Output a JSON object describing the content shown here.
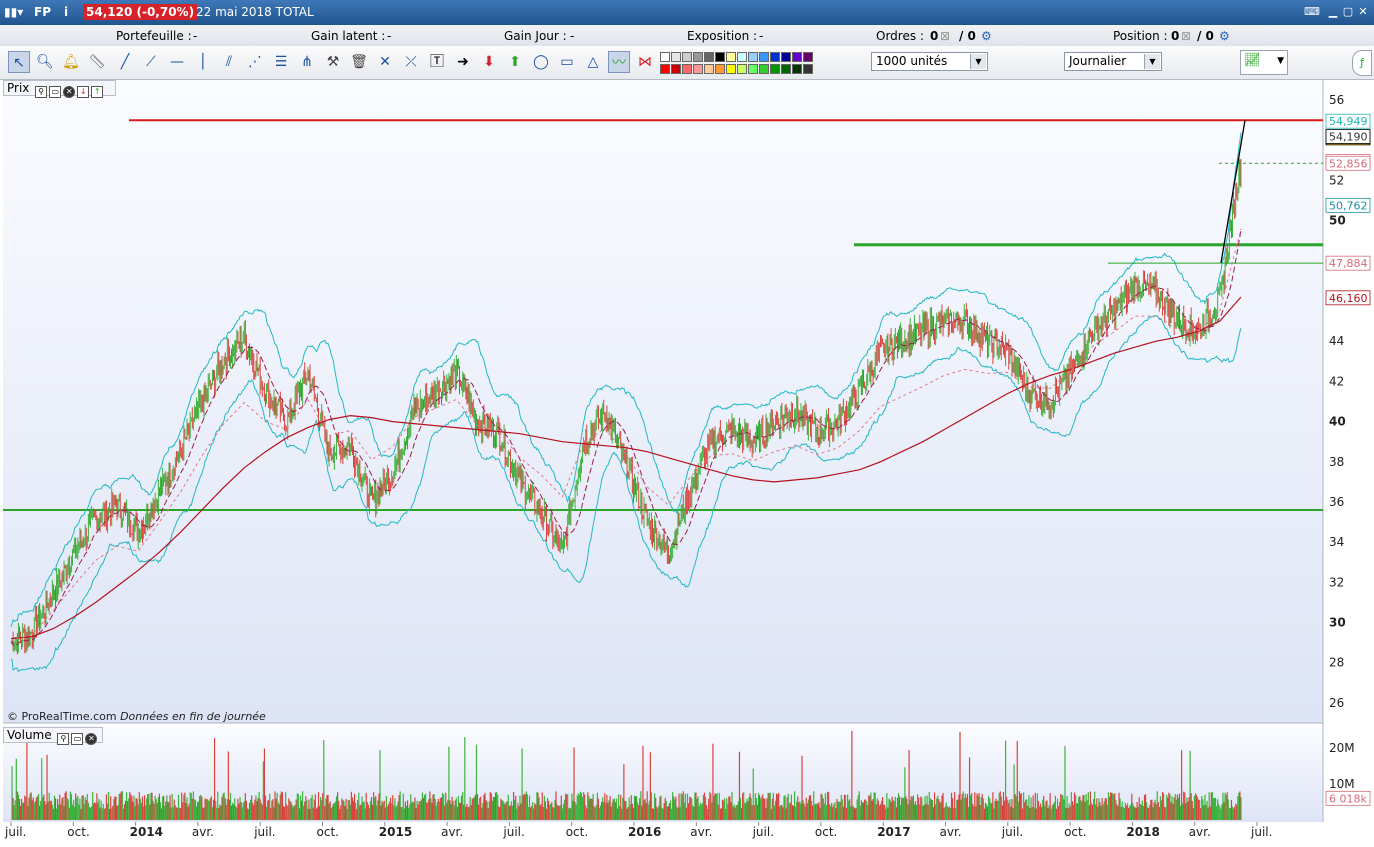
{
  "titlebar": {
    "symbol": "FP",
    "price_change": "54,120 (-0,70%)",
    "date_product": "22 mai 2018 TOTAL"
  },
  "infobar": {
    "portefeuille": "Portefeuille :",
    "portefeuille_val": "-",
    "gain_latent": "Gain latent :",
    "gain_latent_val": "-",
    "gain_jour": "Gain Jour :",
    "gain_jour_val": "-",
    "exposition": "Exposition :",
    "exposition_val": "-",
    "ordres": "Ordres :",
    "ordres_a": "0",
    "ordres_b": "/ 0",
    "position": "Position :",
    "position_a": "0",
    "position_b": "/ 0"
  },
  "toolbar": {
    "quantity_value": "1000 unités",
    "period_value": "Journalier",
    "palette_colors": [
      "#ffffff",
      "#e6e6e6",
      "#cccccc",
      "#999999",
      "#666666",
      "#000000",
      "#ffff99",
      "#ccffff",
      "#99ccff",
      "#3399ff",
      "#0033cc",
      "#000099",
      "#6600cc",
      "#660066",
      "#ff0000",
      "#cc0000",
      "#ff6666",
      "#ff9999",
      "#ffcc99",
      "#ff9933",
      "#ffff00",
      "#ccff66",
      "#66ff66",
      "#33cc33",
      "#009900",
      "#006600",
      "#003300",
      "#333333"
    ]
  },
  "price_panel": {
    "label": "Prix",
    "watermark": "© ProRealTime.com",
    "watermark_note": "Données en fin de journée",
    "y_ticks": [
      "56",
      "52",
      "50",
      "44",
      "42",
      "40",
      "38",
      "36",
      "34",
      "32",
      "30",
      "28",
      "26"
    ],
    "price_tags": [
      {
        "text": "54,949",
        "color": "#21b3b3"
      },
      {
        "text": "54,120",
        "color": "#000000",
        "bg": "#f5c518"
      },
      {
        "text": "54,190",
        "color": "#000000"
      },
      {
        "text": "52,856",
        "color": "#d66b7a"
      },
      {
        "text": "52,856",
        "color": "#d66b7a"
      },
      {
        "text": "50,762",
        "color": "#1a8fa0"
      },
      {
        "text": "47,884",
        "color": "#d66b7a"
      },
      {
        "text": "46,160",
        "color": "#b3121d"
      }
    ]
  },
  "volume_panel": {
    "label": "Volume",
    "y_ticks": [
      "20M",
      "10M"
    ],
    "last_value": "6 018k"
  },
  "x_axis": {
    "labels": [
      "juil.",
      "oct.",
      "2014",
      "avr.",
      "juil.",
      "oct.",
      "2015",
      "avr.",
      "juil.",
      "oct.",
      "2016",
      "avr.",
      "juil.",
      "oct.",
      "2017",
      "avr.",
      "juil.",
      "oct.",
      "2018",
      "avr.",
      "juil."
    ]
  },
  "chart_data": {
    "type": "line",
    "instrument": "TOTAL",
    "x": [
      "2013-07",
      "2013-08",
      "2013-09",
      "2013-10",
      "2013-11",
      "2013-12",
      "2014-01",
      "2014-02",
      "2014-03",
      "2014-04",
      "2014-05",
      "2014-06",
      "2014-07",
      "2014-08",
      "2014-09",
      "2014-10",
      "2014-11",
      "2014-12",
      "2015-01",
      "2015-02",
      "2015-03",
      "2015-04",
      "2015-05",
      "2015-06",
      "2015-07",
      "2015-08",
      "2015-09",
      "2015-10",
      "2015-11",
      "2015-12",
      "2016-01",
      "2016-02",
      "2016-03",
      "2016-04",
      "2016-05",
      "2016-06",
      "2016-07",
      "2016-08",
      "2016-09",
      "2016-10",
      "2016-11",
      "2016-12",
      "2017-01",
      "2017-02",
      "2017-03",
      "2017-04",
      "2017-05",
      "2017-06",
      "2017-07",
      "2017-08",
      "2017-09",
      "2017-10",
      "2017-11",
      "2017-12",
      "2018-01",
      "2018-02",
      "2018-03",
      "2018-04",
      "2018-05"
    ],
    "series": [
      {
        "values": [
          29.0,
          29.5,
          31.5,
          33.5,
          35.2,
          35.8,
          34.5,
          36.5,
          38.5,
          41.0,
          43.0,
          44.2,
          41.5,
          40.0,
          42.5,
          38.5,
          38.8,
          36.0,
          37.5,
          40.5,
          41.5,
          42.5,
          40.0,
          39.5,
          37.0,
          35.5,
          33.5,
          39.0,
          40.5,
          38.0,
          35.0,
          33.5,
          36.5,
          39.0,
          39.5,
          39.0,
          40.0,
          40.5,
          39.5,
          40.0,
          41.5,
          43.5,
          44.0,
          44.5,
          45.0,
          45.0,
          44.0,
          43.5,
          41.5,
          41.0,
          42.5,
          44.5,
          45.5,
          46.8,
          46.5,
          45.0,
          44.5,
          46.0,
          53.0
        ]
      },
      {
        "values": [
          29.2,
          29.3,
          29.7,
          30.3,
          31.0,
          31.8,
          32.6,
          33.5,
          34.5,
          35.6,
          36.7,
          37.7,
          38.5,
          39.2,
          39.7,
          40.1,
          40.3,
          40.2,
          40.0,
          39.9,
          39.8,
          39.7,
          39.6,
          39.5,
          39.4,
          39.2,
          39.0,
          38.9,
          38.8,
          38.7,
          38.5,
          38.2,
          37.9,
          37.6,
          37.3,
          37.1,
          37.0,
          37.1,
          37.2,
          37.4,
          37.6,
          38.0,
          38.5,
          39.0,
          39.6,
          40.2,
          40.8,
          41.4,
          41.9,
          42.3,
          42.6,
          43.0,
          43.4,
          43.7,
          44.0,
          44.2,
          44.5,
          45.0,
          46.2
        ]
      }
    ],
    "ylim": [
      25,
      57
    ],
    "levels": [
      {
        "value": 55.0,
        "color": "#d91a1a"
      },
      {
        "value": 48.8,
        "color": "#2aa52a"
      },
      {
        "value": 35.6,
        "color": "#2aa52a"
      }
    ],
    "volume_ylim": [
      0,
      25
    ]
  }
}
